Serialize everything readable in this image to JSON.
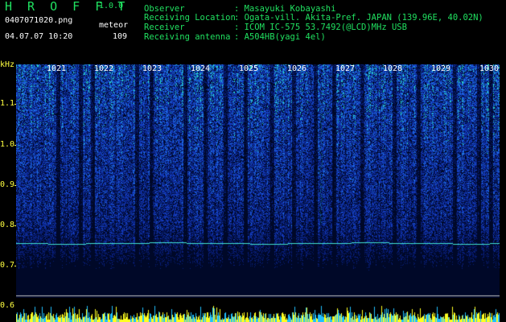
{
  "app": {
    "title": "H R O F F T",
    "version": "1.0.0",
    "filename": "0407071020.png",
    "mode": "meteor",
    "datetime": "04.07.07 10:20",
    "count": "109"
  },
  "info": [
    {
      "key": "Observer",
      "value": ": Masayuki Kobayashi"
    },
    {
      "key": "Receiving Location",
      "value": ": Ogata-vill. Akita-Pref. JAPAN (139.96E, 40.02N)"
    },
    {
      "key": "Receiver",
      "value": ": ICOM IC-575 53.7492(@LCD)MHz USB"
    },
    {
      "key": "Receiving antenna",
      "value": ": A504HB(yagi 4el)"
    }
  ],
  "axis": {
    "unit": "kHz",
    "labels": [
      "1.1",
      "1.0",
      "0.9",
      "0.8",
      "0.7",
      "0.6"
    ]
  },
  "time_labels": [
    "1021",
    "1022",
    "1023",
    "1024",
    "1025",
    "1026",
    "1027",
    "1028",
    "1029",
    "1030"
  ],
  "colors": {
    "header_green": "#20e060",
    "text_white": "#ffffff",
    "axis_yellow": "#ffff40",
    "spectrum_low": "#000818",
    "spectrum_mid": "#1040c0",
    "spectrum_high": "#20e0c0"
  }
}
